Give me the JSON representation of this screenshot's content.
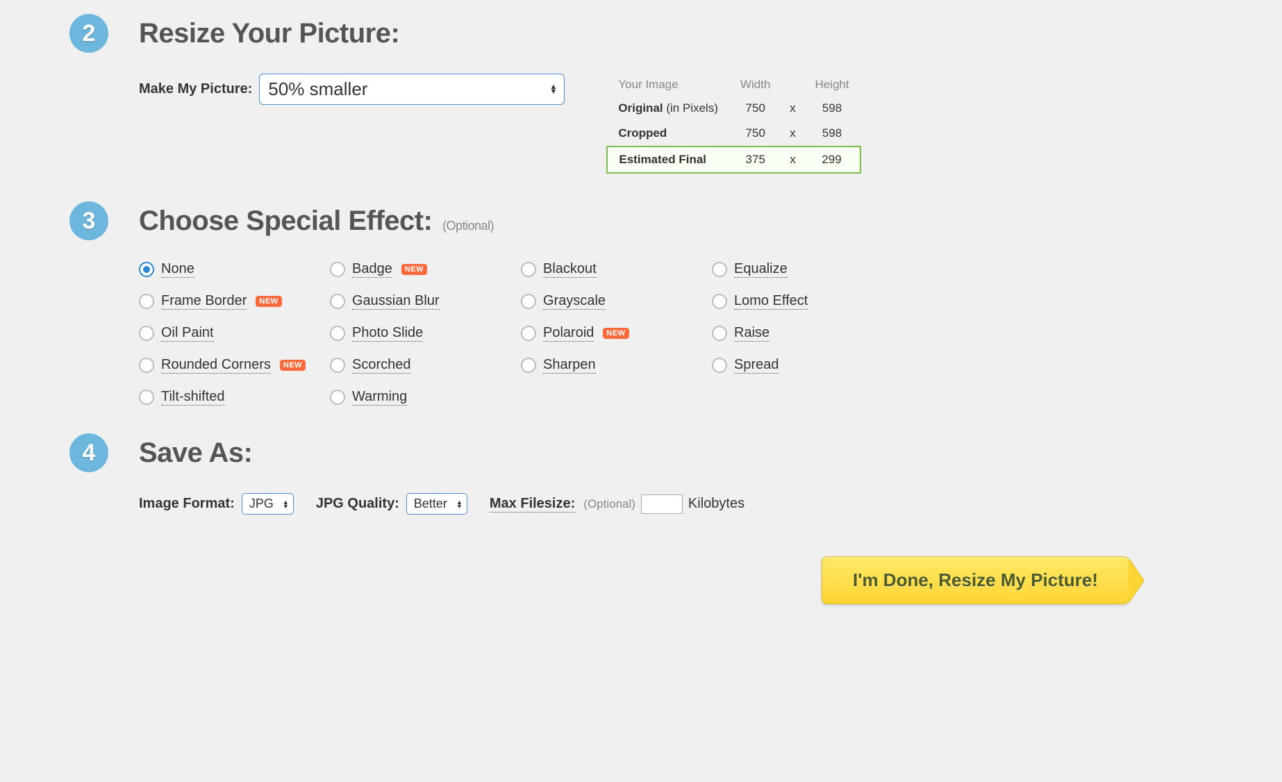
{
  "step2": {
    "number": "2",
    "title": "Resize Your Picture:",
    "make_label": "Make My Picture:",
    "selected": "50% smaller",
    "table": {
      "headers": [
        "Your Image",
        "Width",
        "Height"
      ],
      "rows": [
        {
          "label": "Original",
          "sublabel": "(in Pixels)",
          "width": "750",
          "height": "598"
        },
        {
          "label": "Cropped",
          "sublabel": "",
          "width": "750",
          "height": "598"
        },
        {
          "label": "Estimated Final",
          "sublabel": "",
          "width": "375",
          "height": "299",
          "final": true
        }
      ],
      "separator": "x"
    }
  },
  "step3": {
    "number": "3",
    "title": "Choose Special Effect:",
    "optional": "(Optional)",
    "effects": [
      {
        "label": "None",
        "checked": true,
        "new": false
      },
      {
        "label": "Badge",
        "checked": false,
        "new": true
      },
      {
        "label": "Blackout",
        "checked": false,
        "new": false
      },
      {
        "label": "Equalize",
        "checked": false,
        "new": false
      },
      {
        "label": "Frame Border",
        "checked": false,
        "new": true
      },
      {
        "label": "Gaussian Blur",
        "checked": false,
        "new": false
      },
      {
        "label": "Grayscale",
        "checked": false,
        "new": false
      },
      {
        "label": "Lomo Effect",
        "checked": false,
        "new": false
      },
      {
        "label": "Oil Paint",
        "checked": false,
        "new": false
      },
      {
        "label": "Photo Slide",
        "checked": false,
        "new": false
      },
      {
        "label": "Polaroid",
        "checked": false,
        "new": true
      },
      {
        "label": "Raise",
        "checked": false,
        "new": false
      },
      {
        "label": "Rounded Corners",
        "checked": false,
        "new": true
      },
      {
        "label": "Scorched",
        "checked": false,
        "new": false
      },
      {
        "label": "Sharpen",
        "checked": false,
        "new": false
      },
      {
        "label": "Spread",
        "checked": false,
        "new": false
      },
      {
        "label": "Tilt-shifted",
        "checked": false,
        "new": false
      },
      {
        "label": "Warming",
        "checked": false,
        "new": false
      }
    ],
    "new_text": "NEW"
  },
  "step4": {
    "number": "4",
    "title": "Save As:",
    "format_label": "Image Format:",
    "format_value": "JPG",
    "quality_label": "JPG Quality:",
    "quality_value": "Better",
    "max_filesize_label": "Max Filesize:",
    "max_filesize_optional": "(Optional)",
    "max_filesize_value": "",
    "kb_text": "Kilobytes"
  },
  "submit": "I'm Done, Resize My Picture!"
}
